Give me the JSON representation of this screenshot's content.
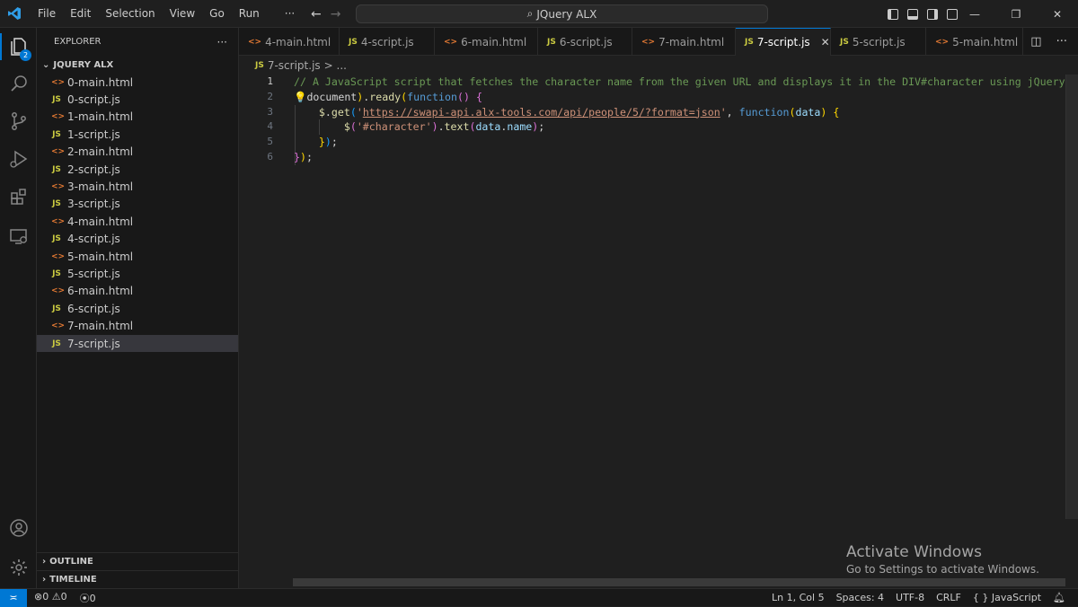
{
  "window": {
    "title": "JQuery ALX",
    "menu": [
      "File",
      "Edit",
      "Selection",
      "View",
      "Go",
      "Run",
      "···"
    ]
  },
  "activity_bar": {
    "explorer_badge": "2",
    "icons": [
      "files-icon",
      "search-icon",
      "source-control-icon",
      "run-debug-icon",
      "extensions-icon",
      "remote-explorer-icon",
      "account-icon",
      "settings-gear-icon"
    ]
  },
  "sidebar": {
    "header": "EXPLORER",
    "more": "···",
    "folder": "JQUERY ALX",
    "files": [
      {
        "name": "0-main.html",
        "type": "html"
      },
      {
        "name": "0-script.js",
        "type": "js"
      },
      {
        "name": "1-main.html",
        "type": "html"
      },
      {
        "name": "1-script.js",
        "type": "js"
      },
      {
        "name": "2-main.html",
        "type": "html"
      },
      {
        "name": "2-script.js",
        "type": "js"
      },
      {
        "name": "3-main.html",
        "type": "html"
      },
      {
        "name": "3-script.js",
        "type": "js"
      },
      {
        "name": "4-main.html",
        "type": "html"
      },
      {
        "name": "4-script.js",
        "type": "js"
      },
      {
        "name": "5-main.html",
        "type": "html"
      },
      {
        "name": "5-script.js",
        "type": "js"
      },
      {
        "name": "6-main.html",
        "type": "html"
      },
      {
        "name": "6-script.js",
        "type": "js"
      },
      {
        "name": "7-main.html",
        "type": "html"
      },
      {
        "name": "7-script.js",
        "type": "js",
        "active": true
      }
    ],
    "outline": "OUTLINE",
    "timeline": "TIMELINE"
  },
  "tabs": [
    {
      "name": "4-main.html",
      "type": "html"
    },
    {
      "name": "4-script.js",
      "type": "js"
    },
    {
      "name": "6-main.html",
      "type": "html"
    },
    {
      "name": "6-script.js",
      "type": "js"
    },
    {
      "name": "7-main.html",
      "type": "html"
    },
    {
      "name": "7-script.js",
      "type": "js",
      "active": true
    },
    {
      "name": "5-script.js",
      "type": "js"
    },
    {
      "name": "5-main.html",
      "type": "html"
    }
  ],
  "breadcrumb": {
    "file": "7-script.js",
    "rest": "> ..."
  },
  "editor": {
    "language": "JavaScript",
    "line_numbers": [
      "1",
      "2",
      "3",
      "4",
      "5",
      "6"
    ],
    "current_line": 1,
    "lines": [
      "// A JavaScript script that fetches the character name from the given URL and displays it in the DIV#character using jQuery.",
      "$(document).ready(function() {",
      "    $.get('https://swapi-api.alx-tools.com/api/people/5/?format=json', function(data) {",
      "        $('#character').text(data.name);",
      "    });",
      "});"
    ]
  },
  "watermark": {
    "line1": "Activate Windows",
    "line2": "Go to Settings to activate Windows."
  },
  "status_bar": {
    "errors": "0",
    "warnings": "0",
    "ports": "0",
    "position": "Ln 1, Col 5",
    "spaces": "Spaces: 4",
    "encoding": "UTF-8",
    "eol": "CRLF",
    "language": "JavaScript"
  },
  "colors": {
    "accent": "#0078d4",
    "html_icon": "#e37933",
    "js_icon": "#cbcb41"
  }
}
